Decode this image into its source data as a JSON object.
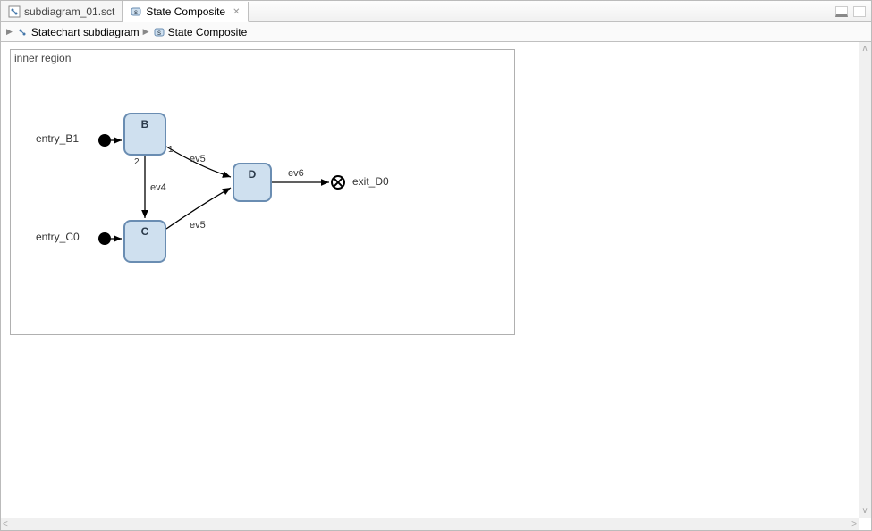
{
  "tabs": [
    {
      "label": "subdiagram_01.sct",
      "active": false
    },
    {
      "label": "State Composite",
      "active": true
    }
  ],
  "breadcrumb": {
    "items": [
      {
        "label": "Statechart subdiagram"
      },
      {
        "label": "State Composite"
      }
    ]
  },
  "region": {
    "title": "inner region",
    "entries": [
      {
        "id": "entry_B1",
        "label": "entry_B1"
      },
      {
        "id": "entry_C0",
        "label": "entry_C0"
      }
    ],
    "states": [
      {
        "id": "B",
        "label": "B"
      },
      {
        "id": "C",
        "label": "C"
      },
      {
        "id": "D",
        "label": "D"
      }
    ],
    "exits": [
      {
        "id": "exit_D0",
        "label": "exit_D0"
      }
    ],
    "transitions": [
      {
        "from": "entry_B1",
        "to": "B",
        "label": ""
      },
      {
        "from": "entry_C0",
        "to": "C",
        "label": ""
      },
      {
        "from": "B",
        "to": "D",
        "label": "ev5",
        "port": "1"
      },
      {
        "from": "B",
        "to": "C",
        "label": "ev4",
        "port": "2"
      },
      {
        "from": "C",
        "to": "D",
        "label": "ev5"
      },
      {
        "from": "D",
        "to": "exit_D0",
        "label": "ev6"
      }
    ]
  }
}
